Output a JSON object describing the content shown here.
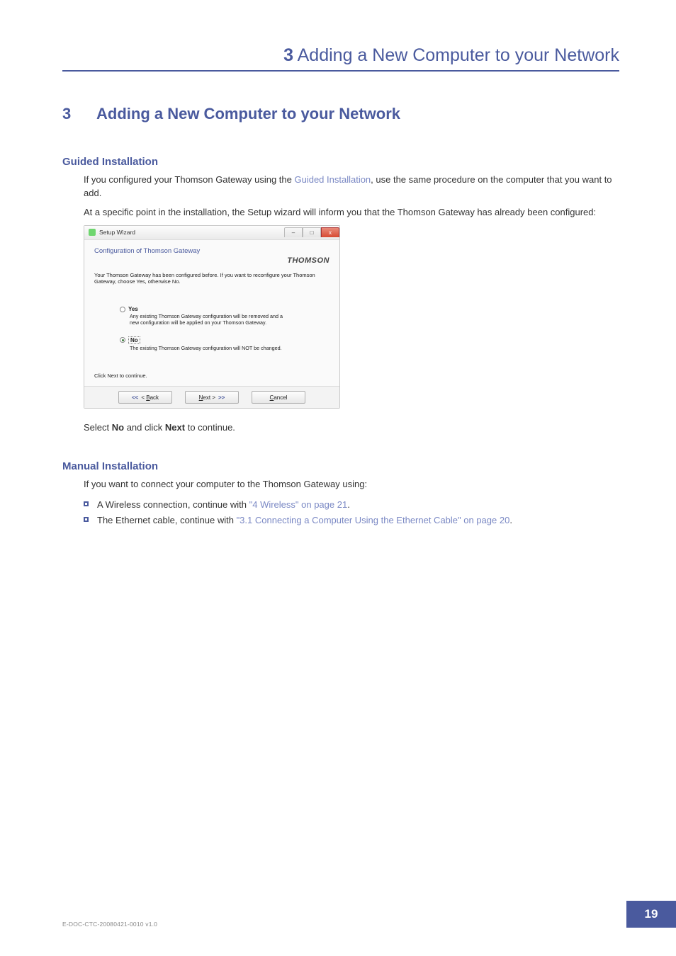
{
  "header": {
    "number": "3",
    "title": "Adding a New Computer to your Network"
  },
  "main_heading": {
    "number": "3",
    "title": "Adding a New Computer to your Network"
  },
  "section_guided": {
    "title": "Guided Installation",
    "para1_a": "If you configured your Thomson Gateway using the ",
    "para1_link": "Guided Installation",
    "para1_b": ", use the same procedure on the computer that you want to add.",
    "para2": "At a specific point in the installation, the Setup wizard will inform you that the Thomson Gateway has already been configured:",
    "after_a": "Select ",
    "after_no": "No",
    "after_b": " and click ",
    "after_next": "Next",
    "after_c": " to continue."
  },
  "wizard": {
    "titlebar": "Setup Wizard",
    "min": "–",
    "max": "□",
    "close": "x",
    "heading": "Configuration of Thomson Gateway",
    "brand": "THOMSON",
    "intro": "Your Thomson Gateway has been configured before. If you want to reconfigure your Thomson Gateway, choose Yes, otherwise No.",
    "opt_yes_label": "Yes",
    "opt_yes_desc": "Any existing Thomson Gateway configuration will be removed and a new configuration will be applied on your Thomson Gateway.",
    "opt_no_label": "No",
    "opt_no_desc": "The existing Thomson Gateway configuration will NOT be changed.",
    "continue_hint": "Click Next to continue.",
    "btn_back_arr": "<<",
    "btn_back_pre": "< ",
    "btn_back_u": "B",
    "btn_back_rest": "ack",
    "btn_next_u": "N",
    "btn_next_rest": "ext >",
    "btn_next_arr": ">>",
    "btn_cancel_u": "C",
    "btn_cancel_rest": "ancel"
  },
  "section_manual": {
    "title": "Manual Installation",
    "intro": "If you want to connect your computer to the Thomson Gateway using:",
    "b1_a": "A Wireless connection, continue with ",
    "b1_link": "\"4 Wireless\" on page 21",
    "b1_b": ".",
    "b2_a": "The Ethernet cable, continue with ",
    "b2_link": "\"3.1 Connecting a Computer Using the Ethernet Cable\" on page 20",
    "b2_b": "."
  },
  "footer": {
    "doc_id": "E-DOC-CTC-20080421-0010 v1.0",
    "page": "19"
  }
}
